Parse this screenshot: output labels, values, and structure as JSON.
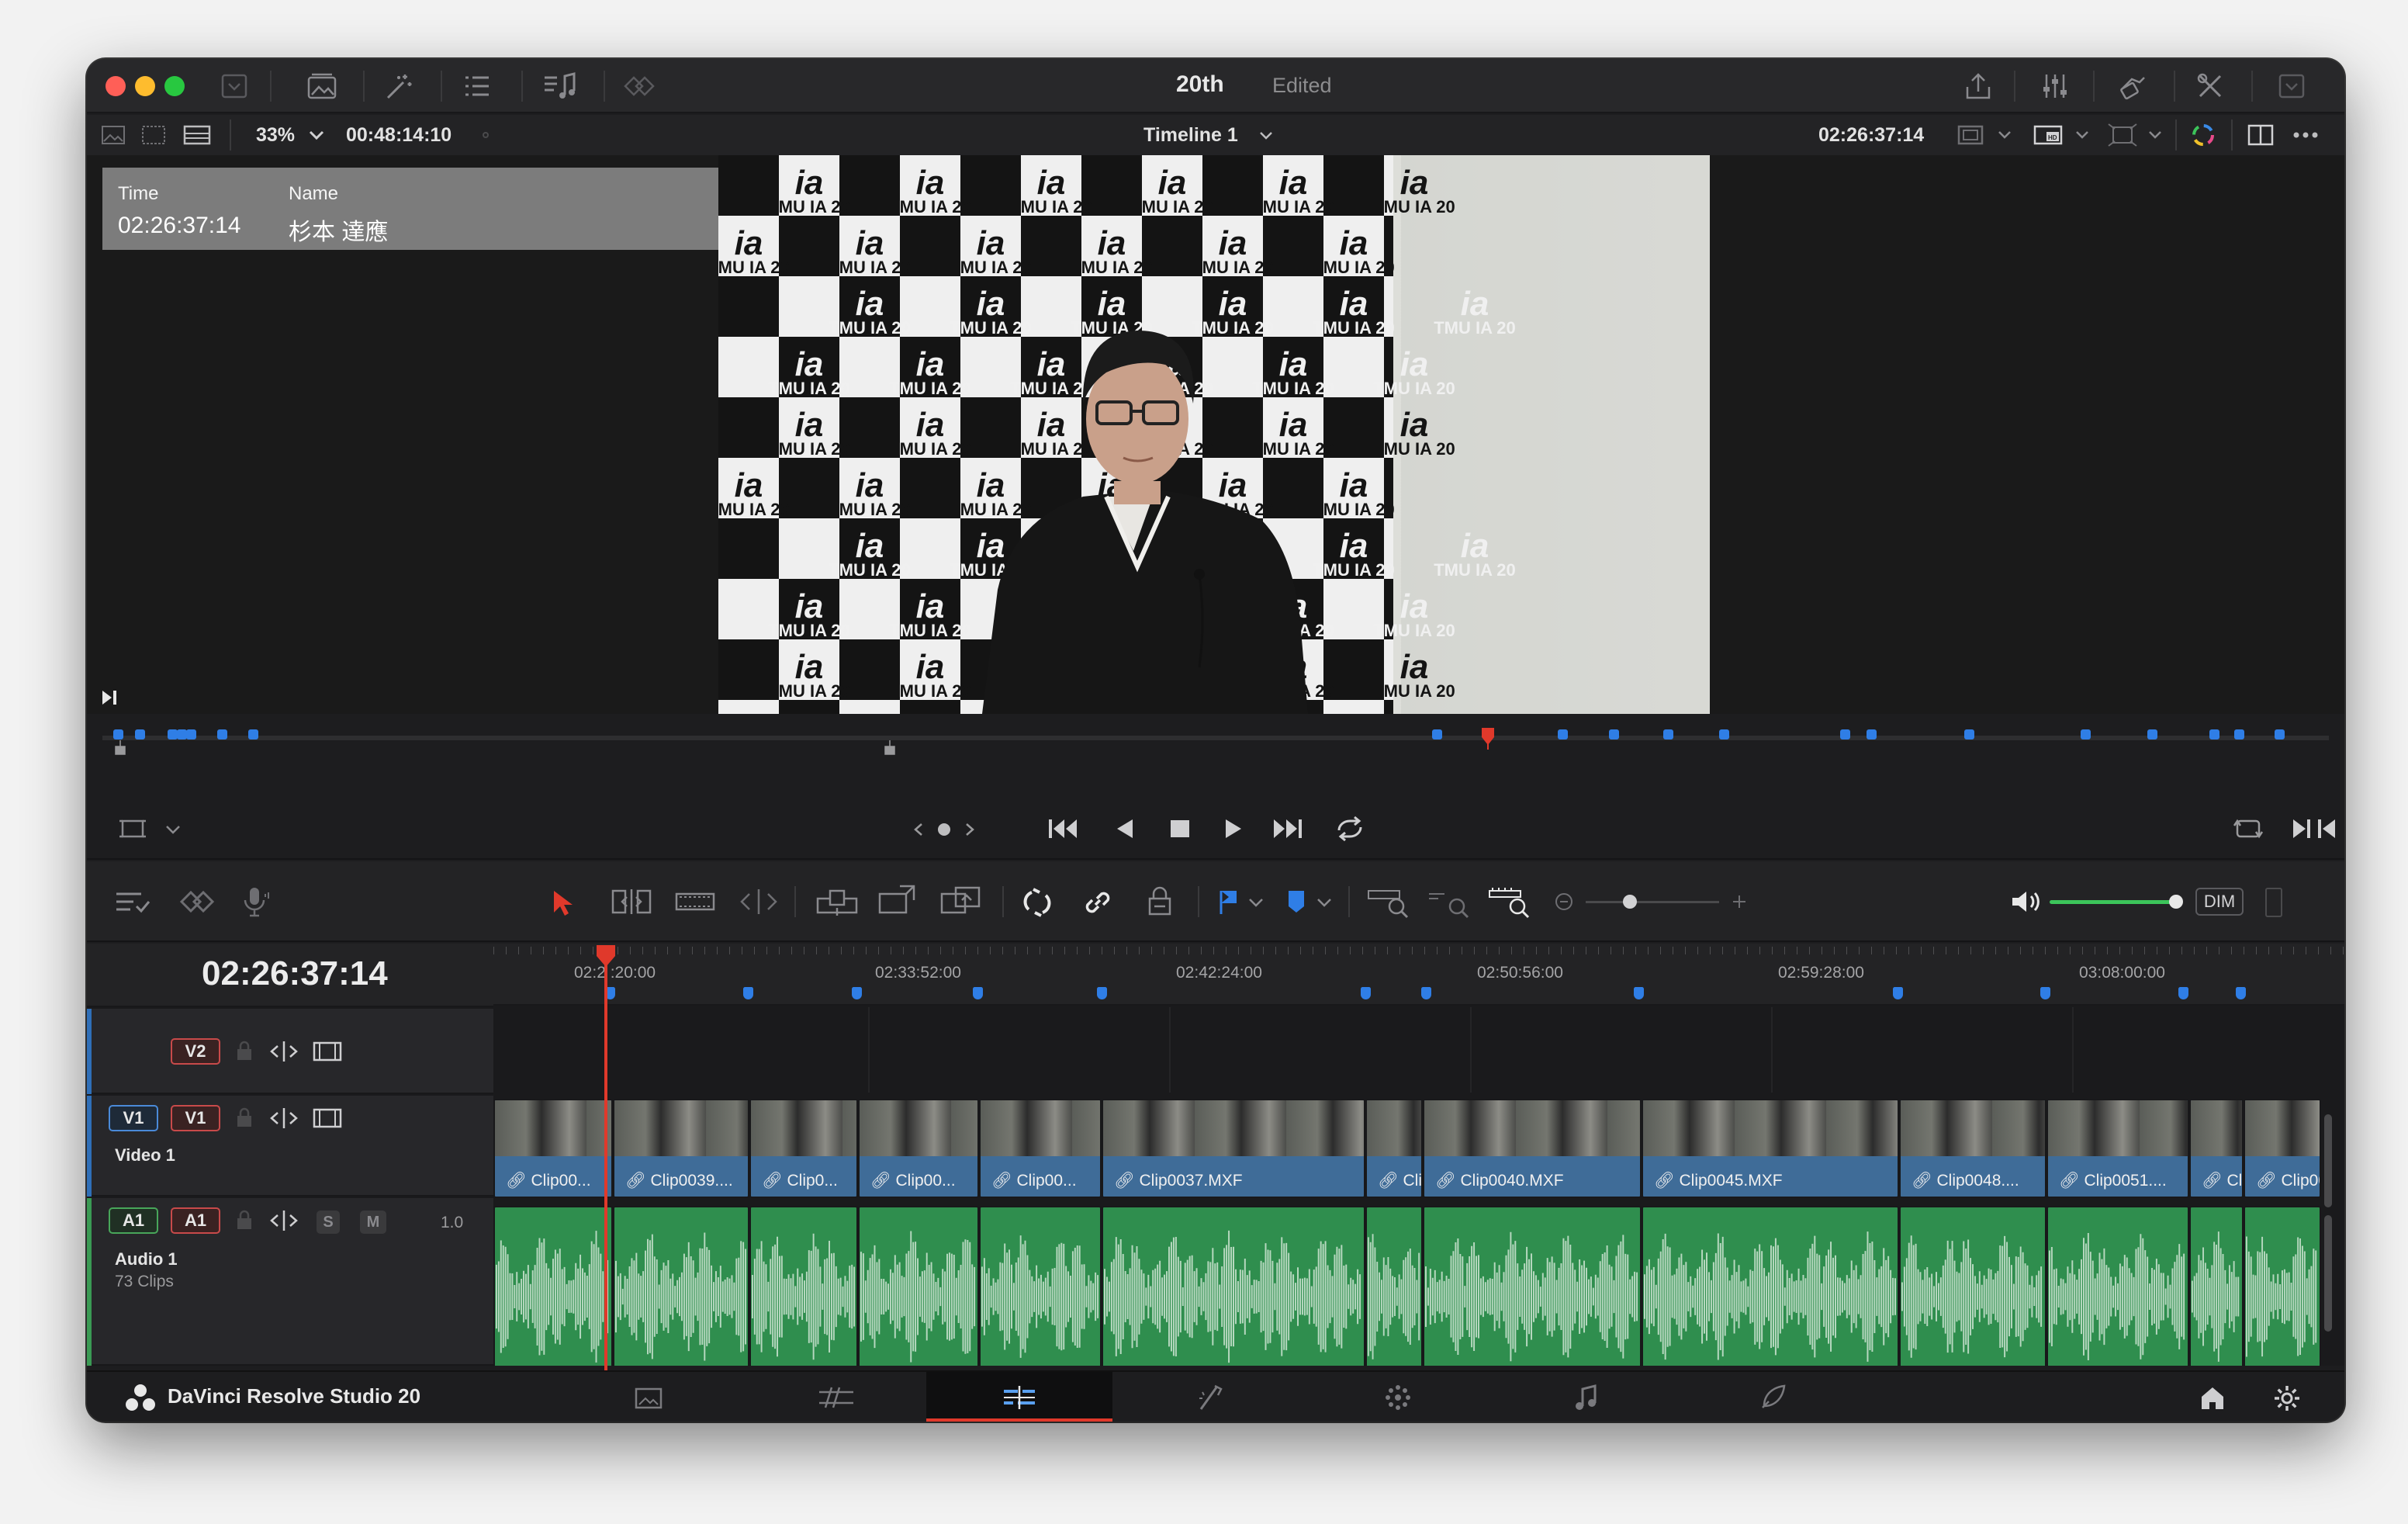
{
  "window": {
    "title": "20th",
    "status": "Edited"
  },
  "viewer_header": {
    "zoom": "33%",
    "source_timecode": "00:48:14:10",
    "timeline_name": "Timeline 1",
    "timeline_timecode": "02:26:37:14"
  },
  "metadata_overlay": {
    "time_label": "Time",
    "name_label": "Name",
    "time_value": "02:26:37:14",
    "name_value": "杉本 達應"
  },
  "video": {
    "logo_word": "TMU IA 20",
    "logo_mark": "ia"
  },
  "timeline": {
    "current_timecode": "02:26:37:14",
    "ruler_labels": [
      "02:2 :20:00",
      "02:33:52:00",
      "02:42:24:00",
      "02:50:56:00",
      "02:59:28:00",
      "03:08:00:00"
    ],
    "tracks": {
      "v2": {
        "label": "V2"
      },
      "v1": {
        "src_label": "V1",
        "dst_label": "V1",
        "name": "Video 1"
      },
      "a1": {
        "src_label": "A1",
        "dst_label": "A1",
        "name": "Audio 1",
        "clip_count": "73 Clips",
        "solo": "S",
        "mute": "M",
        "volume": "1.0"
      }
    },
    "clips": [
      {
        "label": "Clip00..."
      },
      {
        "label": "Clip0039...."
      },
      {
        "label": "Clip0..."
      },
      {
        "label": "Clip00..."
      },
      {
        "label": "Clip00..."
      },
      {
        "label": "Clip0037.MXF"
      },
      {
        "label": "Clip..."
      },
      {
        "label": "Clip0040.MXF"
      },
      {
        "label": "Clip0045.MXF"
      },
      {
        "label": "Clip0048...."
      },
      {
        "label": "Clip0051...."
      },
      {
        "label": "Cli..."
      },
      {
        "label": "Clip00..."
      }
    ]
  },
  "toolbar": {
    "dim_label": "DIM"
  },
  "pagebar": {
    "app_name": "DaVinci Resolve Studio 20",
    "active_page": "edit"
  },
  "colors": {
    "accent_red": "#e0392b",
    "marker_blue": "#2f7ee6",
    "video_clip": "#3f6c98",
    "audio_clip": "#2f8e4e",
    "volume_green": "#3cc45a"
  }
}
